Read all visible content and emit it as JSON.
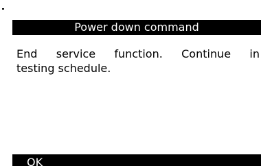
{
  "dialog": {
    "title": "Power down command",
    "message_lines": [
      "End service function. Continue in",
      "testing schedule."
    ],
    "ok_label": "OK"
  },
  "colors": {
    "bar_background": "#000000",
    "bar_text": "#ffffff",
    "page_background": "#ffffff",
    "body_text": "#000000"
  }
}
